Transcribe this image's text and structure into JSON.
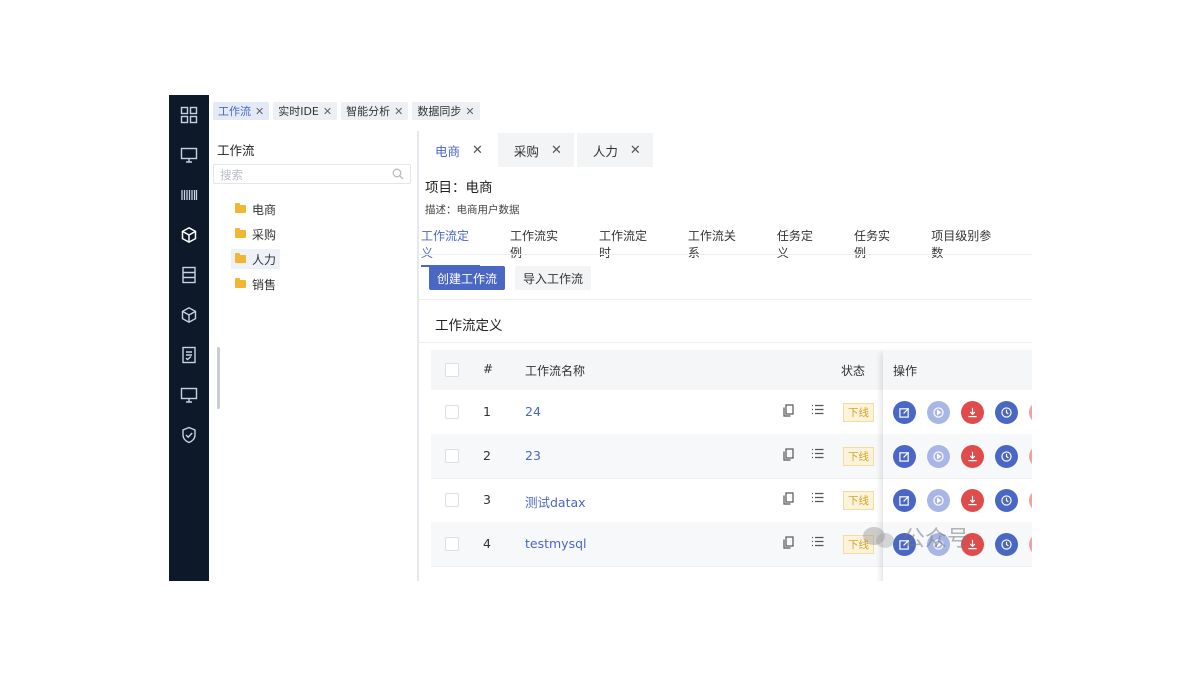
{
  "top_tabs": [
    {
      "label": "工作流",
      "active": true
    },
    {
      "label": "实时IDE",
      "active": false
    },
    {
      "label": "智能分析",
      "active": false
    },
    {
      "label": "数据同步",
      "active": false
    }
  ],
  "tree": {
    "title": "工作流",
    "search_placeholder": "搜索",
    "items": [
      {
        "label": "电商",
        "selected": false
      },
      {
        "label": "采购",
        "selected": false
      },
      {
        "label": "人力",
        "selected": true
      },
      {
        "label": "销售",
        "selected": false
      }
    ]
  },
  "file_tabs": [
    {
      "label": "电商",
      "active": true
    },
    {
      "label": "采购",
      "active": false
    },
    {
      "label": "人力",
      "active": false
    }
  ],
  "project": {
    "name": "项目：电商",
    "desc": "描述：电商用户数据"
  },
  "sub_tabs": [
    "工作流定义",
    "工作流实例",
    "工作流定时",
    "工作流关系",
    "任务定义",
    "任务实例",
    "项目级别参数"
  ],
  "actions": {
    "create": "创建工作流",
    "import": "导入工作流"
  },
  "section_title": "工作流定义",
  "table": {
    "headers": {
      "index": "#",
      "name": "工作流名称",
      "status": "状态",
      "ops": "操作"
    },
    "rows": [
      {
        "index": "1",
        "name": "24",
        "status": "下线"
      },
      {
        "index": "2",
        "name": "23",
        "status": "下线"
      },
      {
        "index": "3",
        "name": "测试datax",
        "status": "下线"
      },
      {
        "index": "4",
        "name": "testmysql",
        "status": "下线"
      }
    ]
  },
  "watermark": "公众号 ·",
  "colors": {
    "accent": "#4a67c4",
    "rail": "#0d1929",
    "danger": "#e04b4b",
    "badge_bg": "#fcf3da",
    "badge_text": "#d4a42c"
  }
}
